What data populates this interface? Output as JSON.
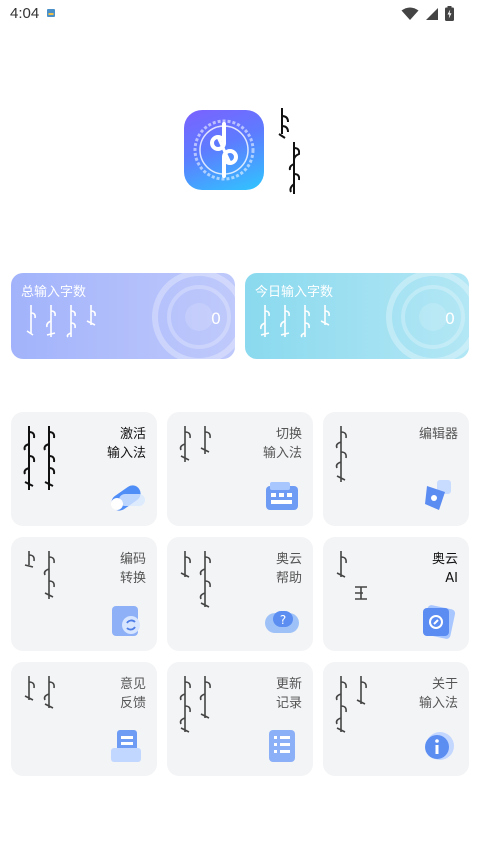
{
  "status_bar": {
    "time": "4:04"
  },
  "stats": [
    {
      "title": "总输入字数",
      "value": "0"
    },
    {
      "title": "今日输入字数",
      "value": "0"
    }
  ],
  "menu": [
    {
      "label": "激活\n输入法"
    },
    {
      "label": "切换\n输入法"
    },
    {
      "label": "编辑器"
    },
    {
      "label": "编码\n转换"
    },
    {
      "label": "奥云\n帮助"
    },
    {
      "label": "奥云\nAI"
    },
    {
      "label": "意见\n反馈"
    },
    {
      "label": "更新\n记录"
    },
    {
      "label": "关于\n输入法"
    }
  ],
  "icons": {
    "menu": [
      "toggle-icon",
      "keyboard-icon",
      "pen-icon",
      "convert-icon",
      "help-icon",
      "ai-icon",
      "feedback-icon",
      "changelog-icon",
      "info-icon"
    ],
    "status": [
      "notification-icon",
      "wifi-icon",
      "signal-icon",
      "battery-icon"
    ]
  },
  "colors": {
    "brand_purple": "#7b61ff",
    "brand_cyan": "#2fc6ff",
    "card_total": "#a2b3fb",
    "card_today": "#8ad9ee",
    "menu_bg": "#f3f4f6"
  }
}
